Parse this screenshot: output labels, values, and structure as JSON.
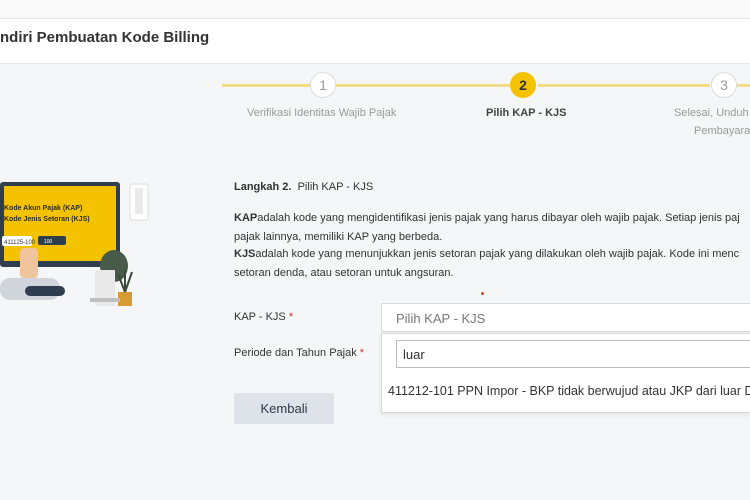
{
  "header": {
    "title": "ndiri Pembuatan Kode Billing"
  },
  "stepper": {
    "steps": [
      {
        "number": "1",
        "label": "Verifikasi Identitas Wajib Pajak"
      },
      {
        "number": "2",
        "label": "Pilih KAP - KJS"
      },
      {
        "number": "3",
        "label_line1": "Selesai, Unduh",
        "label_line2": "Pembayara"
      }
    ]
  },
  "illustration": {
    "line1": "Kode Akun Pajak (KAP)",
    "line2": "Kode Jenis Setoran (KJS)",
    "code": "411125-100",
    "tag": "100"
  },
  "content": {
    "heading_bold": "Langkah 2.",
    "heading_text": "Pilih KAP - KJS",
    "kap_bold": "KAP",
    "kap_text_1": "adalah kode yang mengidentifikasi jenis pajak yang harus dibayar oleh wajib pajak. Setiap jenis paj",
    "kap_text_2": "pajak lainnya, memiliki KAP yang berbeda.",
    "kjs_bold": "KJS",
    "kjs_text_1": "adalah kode yang menunjukkan jenis setoran pajak yang dilakukan oleh wajib pajak. Kode ini menc",
    "kjs_text_2": "setoran denda, atau setoran untuk angsuran."
  },
  "form": {
    "kap_label": "KAP - KJS",
    "required_mark": "*",
    "kap_placeholder": "Pilih KAP - KJS",
    "period_label": "Periode dan Tahun Pajak",
    "search_value": "luar",
    "option_1": "411212-101 PPN Impor - BKP tidak berwujud atau JKP dari luar D",
    "back_label": "Kembali"
  },
  "colors": {
    "accent": "#f5c200",
    "accent_light": "#f2dc8a",
    "button": "#dde3e8"
  }
}
